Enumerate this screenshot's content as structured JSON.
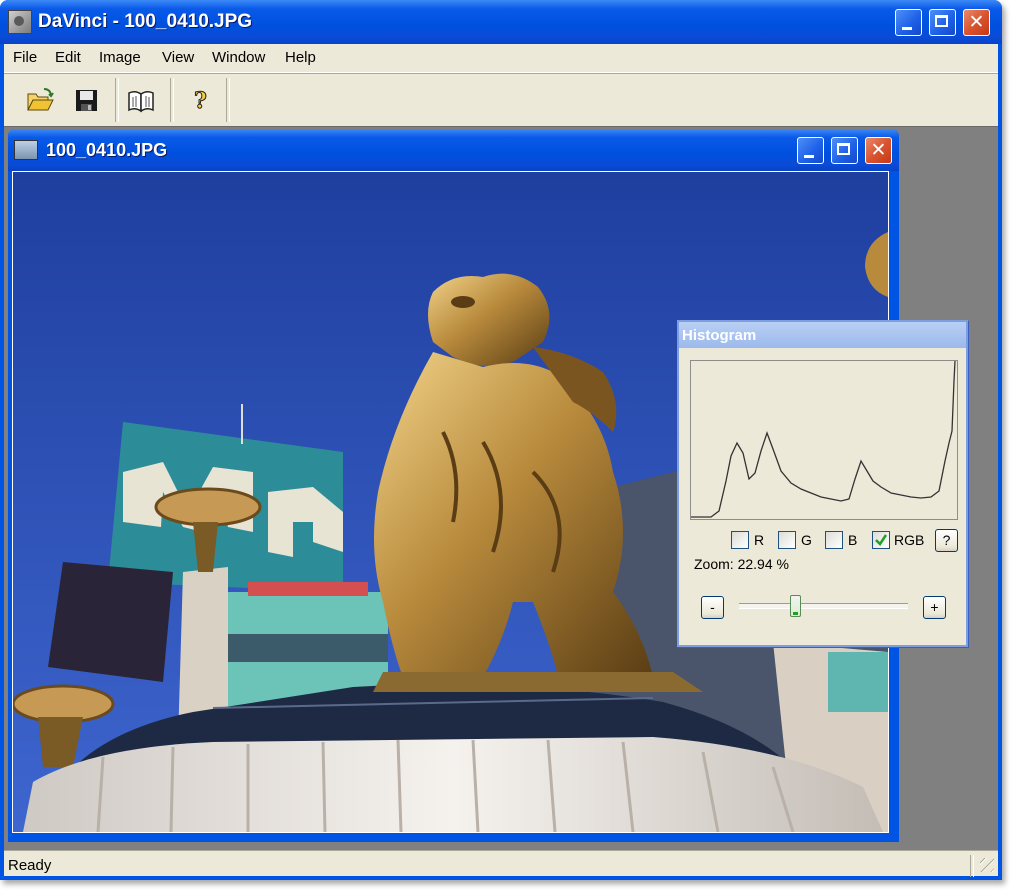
{
  "app": {
    "title": "DaVinci - 100_0410.JPG"
  },
  "menu": {
    "items": [
      "File",
      "Edit",
      "Image",
      "View",
      "Window",
      "Help"
    ]
  },
  "toolbar": {
    "buttons": [
      "open-folder-icon",
      "save-disk-icon",
      "book-icon",
      "help-question-icon"
    ]
  },
  "image_window": {
    "title": "100_0410.JPG"
  },
  "histogram": {
    "title": "Histogram",
    "channels": [
      {
        "label": "R",
        "checked": false
      },
      {
        "label": "G",
        "checked": false
      },
      {
        "label": "B",
        "checked": false
      },
      {
        "label": "RGB",
        "checked": true
      }
    ],
    "help_label": "?",
    "zoom_text": "Zoom:  22.94 %",
    "zoom_minus_label": "-",
    "zoom_plus_label": "+",
    "zoom_slider_level": 0.33
  },
  "status": {
    "text": "Ready"
  }
}
